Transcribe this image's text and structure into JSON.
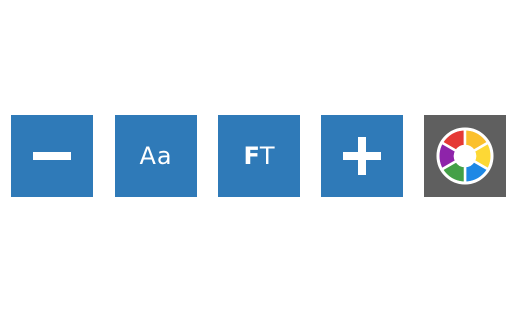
{
  "toolbar": {
    "buttons": [
      {
        "id": "decrease",
        "icon": "minus-icon",
        "color": "#2f7ab8"
      },
      {
        "id": "font-size",
        "label": "Aa",
        "color": "#2f7ab8"
      },
      {
        "id": "font-type",
        "label_bold": "F",
        "label_regular": "T",
        "color": "#2f7ab8"
      },
      {
        "id": "increase",
        "icon": "plus-icon",
        "color": "#2f7ab8"
      },
      {
        "id": "color-picker",
        "icon": "color-wheel-icon",
        "color": "#5f5f5f"
      }
    ]
  },
  "color_wheel": {
    "segments": [
      "#e53935",
      "#fbc02d",
      "#fdd835",
      "#1e88e5",
      "#43a047",
      "#8e24aa"
    ],
    "center": "#ffffff"
  }
}
